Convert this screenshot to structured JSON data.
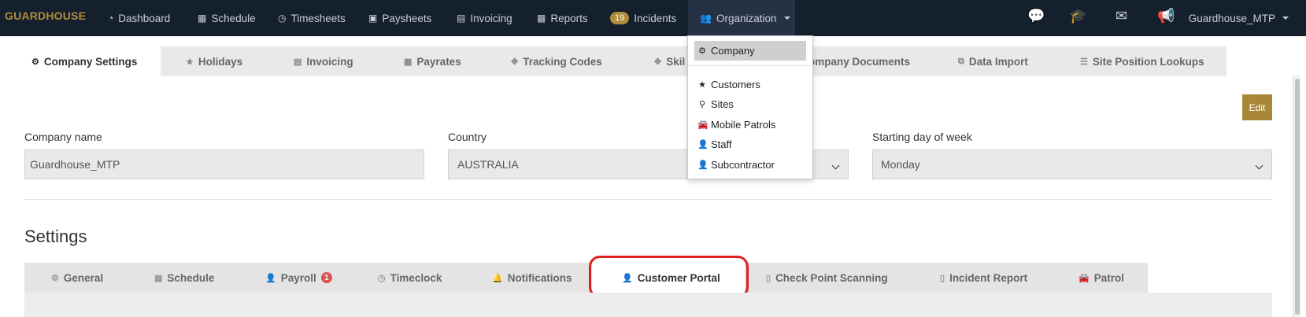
{
  "nav": {
    "brand": "GUARDHOUSE",
    "items": [
      {
        "label": "Dashboard",
        "icon": "dashboard-icon",
        "glyph": "◔"
      },
      {
        "label": "Schedule",
        "icon": "calendar-icon",
        "glyph": "▦"
      },
      {
        "label": "Timesheets",
        "icon": "clock-icon",
        "glyph": "◷"
      },
      {
        "label": "Paysheets",
        "icon": "money-icon",
        "glyph": "▣"
      },
      {
        "label": "Invoicing",
        "icon": "invoice-icon",
        "glyph": "▤"
      },
      {
        "label": "Reports",
        "icon": "table-icon",
        "glyph": "▦"
      },
      {
        "label": "Incidents",
        "icon": "incidents-icon",
        "badge": "19"
      },
      {
        "label": "Organization",
        "icon": "users-icon",
        "glyph": "👥"
      }
    ],
    "right_icons": [
      "chat-icon",
      "graduation-cap-icon",
      "envelope-icon",
      "bullhorn-icon"
    ],
    "user": "Guardhouse_MTP"
  },
  "org_menu": {
    "items": [
      {
        "label": "Company",
        "icon": "gear-icon",
        "glyph": "⚙"
      },
      {
        "label": "Customers",
        "icon": "star-icon",
        "glyph": "★"
      },
      {
        "label": "Sites",
        "icon": "map-marker-icon",
        "glyph": "⚲"
      },
      {
        "label": "Mobile Patrols",
        "icon": "car-icon",
        "glyph": "🚘"
      },
      {
        "label": "Staff",
        "icon": "user-icon",
        "glyph": "👤"
      },
      {
        "label": "Subcontractor",
        "icon": "user-icon",
        "glyph": "👤"
      }
    ]
  },
  "tabs": [
    {
      "label": "Company Settings",
      "icon": "gear-icon",
      "glyph": "⚙"
    },
    {
      "label": "Holidays",
      "icon": "star-icon",
      "glyph": "★"
    },
    {
      "label": "Invoicing",
      "icon": "invoice-icon",
      "glyph": "▤"
    },
    {
      "label": "Payrates",
      "icon": "calendar-icon",
      "glyph": "▦"
    },
    {
      "label": "Tracking Codes",
      "icon": "crosshairs-icon",
      "glyph": "✥"
    },
    {
      "label": "Skil",
      "icon": "skills-icon",
      "glyph": "✥"
    },
    {
      "label": "ompany Documents",
      "icon": "documents-icon",
      "glyph": ""
    },
    {
      "label": "Data Import",
      "icon": "import-icon",
      "glyph": "⧉"
    },
    {
      "label": "Site Position Lookups",
      "icon": "list-icon",
      "glyph": "☰"
    }
  ],
  "edit_label": "Edit",
  "company": {
    "name_label": "Company name",
    "name_value": "Guardhouse_MTP",
    "country_label": "Country",
    "country_value": "AUSTRALIA",
    "week_label": "Starting day of week",
    "week_value": "Monday"
  },
  "settings_title": "Settings",
  "subtabs": [
    {
      "label": "General",
      "icon": "gear-icon",
      "glyph": "⚙"
    },
    {
      "label": "Schedule",
      "icon": "calendar-icon",
      "glyph": "▦"
    },
    {
      "label": "Payroll",
      "icon": "user-icon",
      "glyph": "👤",
      "badge": "1"
    },
    {
      "label": "Timeclock",
      "icon": "clock-icon",
      "glyph": "◷"
    },
    {
      "label": "Notifications",
      "icon": "bell-icon",
      "glyph": "🔔"
    },
    {
      "label": "Customer Portal",
      "icon": "user-icon",
      "glyph": "👤"
    },
    {
      "label": "Check Point Scanning",
      "icon": "file-icon",
      "glyph": "▯"
    },
    {
      "label": "Incident Report",
      "icon": "file-icon",
      "glyph": "▯"
    },
    {
      "label": "Patrol",
      "icon": "car-icon",
      "glyph": "🚘"
    }
  ],
  "colors": {
    "nav_bg": "#15202f",
    "accent": "#a98738",
    "badge_red": "#d9534f",
    "highlight": "#e02020"
  }
}
